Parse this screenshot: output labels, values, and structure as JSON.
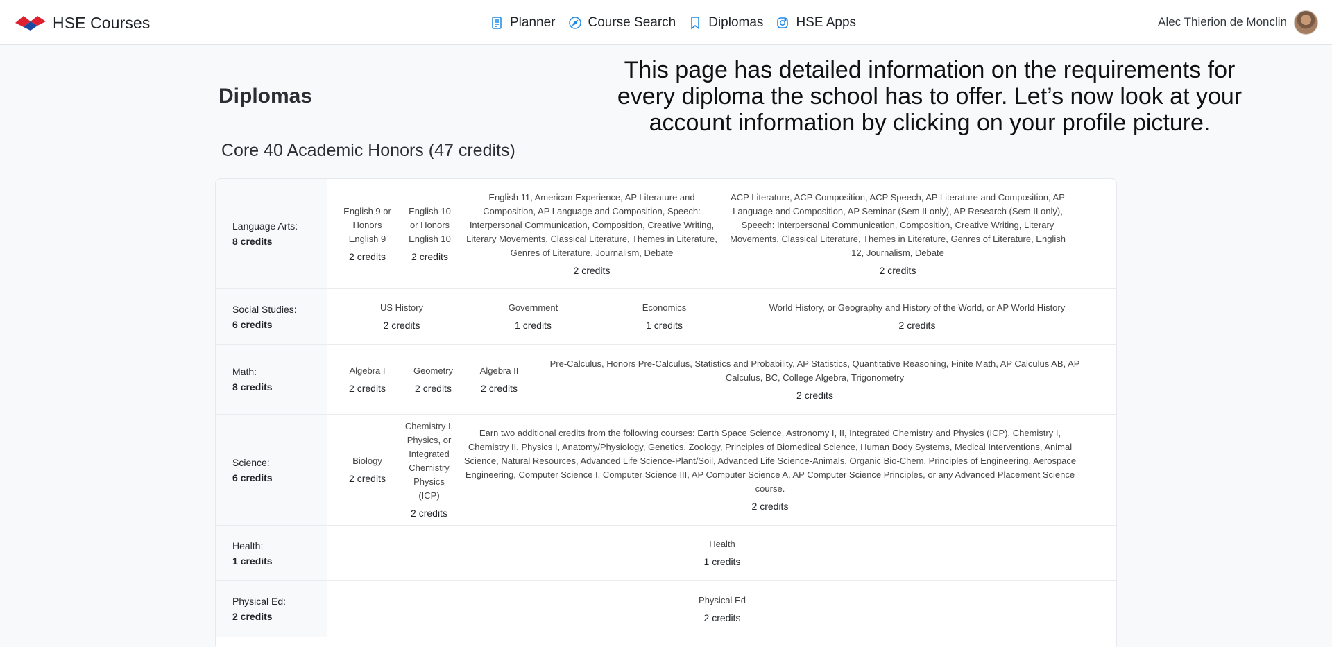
{
  "brand": {
    "name": "HSE Courses",
    "colors": {
      "primary": "#e02030",
      "secondary": "#1c4aa0"
    }
  },
  "nav": {
    "items": [
      {
        "label": "Planner",
        "icon": "planner-icon"
      },
      {
        "label": "Course Search",
        "icon": "compass-icon"
      },
      {
        "label": "Diplomas",
        "icon": "bookmark-icon"
      },
      {
        "label": "HSE Apps",
        "icon": "instagram-icon"
      }
    ],
    "icon_color": "#1e88e5"
  },
  "user": {
    "name": "Alec Thierion de Monclin"
  },
  "tutorial": {
    "text": "This page has detailed information on the requirements for every diploma the school has to offer. Let’s now look at your account information by clicking on your profile picture."
  },
  "page": {
    "title": "Diplomas"
  },
  "diploma": {
    "title": "Core 40 Academic Honors (47 credits)",
    "rows": [
      {
        "subject": "Language Arts:",
        "credits": "8 credits",
        "requirements": [
          {
            "courses": "English 9 or Honors English 9",
            "credits": "2 credits"
          },
          {
            "courses": "English 10 or Honors English 10",
            "credits": "2 credits"
          },
          {
            "courses": "English 11, American Experience, AP Literature and Composition, AP Language and Composition, Speech: Interpersonal Communication, Composition, Creative Writing, Literary Movements, Classical Literature, Themes in Literature, Genres of Literature, Journalism, Debate",
            "credits": "2 credits"
          },
          {
            "courses": "ACP Literature, ACP Composition, ACP Speech, AP Literature and Composition, AP Language and Composition, AP Seminar (Sem II only), AP Research (Sem II only), Speech: Interpersonal Communication, Composition, Creative Writing, Literary Movements, Classical Literature, Themes in Literature, Genres of Literature, English 12, Journalism, Debate",
            "credits": "2 credits"
          }
        ]
      },
      {
        "subject": "Social Studies:",
        "credits": "6 credits",
        "requirements": [
          {
            "courses": "US History",
            "credits": "2 credits"
          },
          {
            "courses": "Government",
            "credits": "1 credits"
          },
          {
            "courses": "Economics",
            "credits": "1 credits"
          },
          {
            "courses": "World History, or Geography and History of the World, or AP World History",
            "credits": "2 credits"
          }
        ]
      },
      {
        "subject": "Math:",
        "credits": "8 credits",
        "requirements": [
          {
            "courses": "Algebra I",
            "credits": "2 credits"
          },
          {
            "courses": "Geometry",
            "credits": "2 credits"
          },
          {
            "courses": "Algebra II",
            "credits": "2 credits"
          },
          {
            "courses": "Pre-Calculus, Honors Pre-Calculus, Statistics and Probability, AP Statistics, Quantitative Reasoning, Finite Math, AP Calculus AB, AP Calculus, BC, College Algebra, Trigonometry",
            "credits": "2 credits"
          }
        ]
      },
      {
        "subject": "Science:",
        "credits": "6 credits",
        "requirements": [
          {
            "courses": "Biology",
            "credits": "2 credits"
          },
          {
            "courses": "Chemistry I, Physics, or Integrated Chemistry Physics (ICP)",
            "credits": "2 credits"
          },
          {
            "courses": "Earn two additional credits from the following courses: Earth Space Science, Astronomy I, II, Integrated Chemistry and Physics (ICP), Chemistry I, Chemistry II, Physics I, Anatomy/Physiology, Genetics, Zoology, Principles of Biomedical Science, Human Body Systems, Medical Interventions, Animal Science, Natural Resources, Advanced Life Science-Plant/Soil, Advanced Life Science-Animals, Organic Bio-Chem, Principles of Engineering, Aerospace Engineering, Computer Science I, Computer Science III, AP Computer Science A, AP Computer Science Principles, or any Advanced Placement Science course.",
            "credits": "2 credits"
          }
        ]
      },
      {
        "subject": "Health:",
        "credits": "1 credits",
        "requirements": [
          {
            "courses": "Health",
            "credits": "1 credits"
          }
        ]
      },
      {
        "subject": "Physical Ed:",
        "credits": "2 credits",
        "requirements": [
          {
            "courses": "Physical Ed",
            "credits": "2 credits"
          }
        ]
      }
    ]
  }
}
